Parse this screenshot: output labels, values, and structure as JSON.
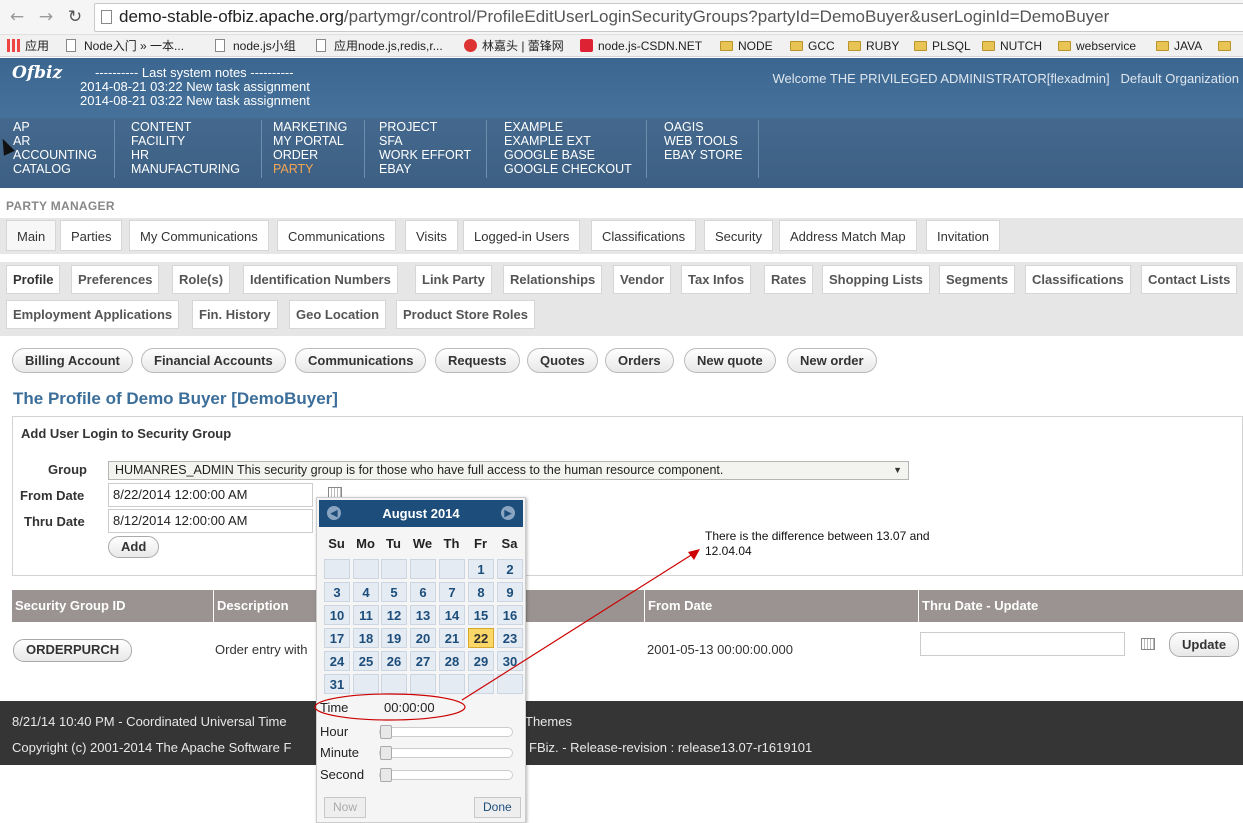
{
  "browser": {
    "url_host": "demo-stable-ofbiz.apache.org",
    "url_path": "/partymgr/control/ProfileEditUserLoginSecurityGroups?partyId=DemoBuyer&userLoginId=DemoBuyer",
    "bookmarks": [
      "应用",
      "Node入门 » 一本...",
      "node.js小组",
      "应用node.js,redis,r...",
      "林嘉头 | 蕾锋网",
      "node.js-CSDN.NET",
      "NODE",
      "GCC",
      "RUBY",
      "PLSQL",
      "NUTCH",
      "webservice",
      "JAVA"
    ]
  },
  "header": {
    "logo": "Ofbiz",
    "notes_title": "---------- Last system notes ----------",
    "notes": [
      "2014-08-21 03:22 New task assignment",
      "2014-08-21 03:22 New task assignment"
    ],
    "welcome": "Welcome THE PRIVILEGED ADMINISTRATOR[flexadmin]",
    "org": "Default Organization"
  },
  "apps": {
    "col1": [
      "AP",
      "AR",
      "ACCOUNTING",
      "CATALOG"
    ],
    "col2": [
      "CONTENT",
      "FACILITY",
      "HR",
      "MANUFACTURING"
    ],
    "col3": [
      "MARKETING",
      "MY PORTAL",
      "ORDER",
      "PARTY"
    ],
    "col4": [
      "PROJECT",
      "SFA",
      "WORK EFFORT",
      "EBAY"
    ],
    "col5": [
      "EXAMPLE",
      "EXAMPLE EXT",
      "GOOGLE BASE",
      "GOOGLE CHECKOUT"
    ],
    "col6": [
      "OAGIS",
      "WEB TOOLS",
      "EBAY STORE"
    ]
  },
  "party_manager": {
    "title": "PARTY MANAGER",
    "tabs": [
      "Main",
      "Parties",
      "My Communications",
      "Communications",
      "Visits",
      "Logged-in Users",
      "Classifications",
      "Security",
      "Address Match Map",
      "Invitation"
    ],
    "sub_tabs": [
      "Profile",
      "Preferences",
      "Role(s)",
      "Identification Numbers",
      "Link Party",
      "Relationships",
      "Vendor",
      "Tax Infos",
      "Rates",
      "Shopping Lists",
      "Segments",
      "Classifications",
      "Contact Lists",
      "Employment Applications",
      "Fin. History",
      "Geo Location",
      "Product Store Roles"
    ],
    "pills": [
      "Billing Account",
      "Financial Accounts",
      "Communications",
      "Requests",
      "Quotes",
      "Orders",
      "New quote",
      "New order"
    ]
  },
  "profile": {
    "title": "The Profile of Demo Buyer [DemoBuyer]",
    "form_title": "Add User Login to Security Group",
    "group_label": "Group",
    "group_value": "HUMANRES_ADMIN This security group is for those who have full access to the human resource component.",
    "from_label": "From Date",
    "from_value": "8/22/2014 12:00:00 AM",
    "thru_label": "Thru Date",
    "thru_value": "8/12/2014 12:00:00 AM",
    "add_label": "Add"
  },
  "grid": {
    "headers": [
      "Security Group ID",
      "Description",
      "From Date",
      "Thru Date - Update"
    ],
    "row": {
      "id": "ORDERPURCH",
      "desc": "Order entry with",
      "from": "2001-05-13 00:00:00.000",
      "thru": "",
      "update_label": "Update"
    }
  },
  "footer": {
    "line1a": "8/21/14 10:40 PM - Coordinated Universal Time",
    "line1b": "Themes",
    "line2a": "Copyright (c) 2001-2014 The Apache Software F",
    "line2b": "FBiz. - Release-revision : release13.07-r1619101"
  },
  "calendar": {
    "month": "August 2014",
    "dow": [
      "Su",
      "Mo",
      "Tu",
      "We",
      "Th",
      "Fr",
      "Sa"
    ],
    "weeks": [
      [
        "",
        "",
        "",
        "",
        "",
        "1",
        "2"
      ],
      [
        "3",
        "4",
        "5",
        "6",
        "7",
        "8",
        "9"
      ],
      [
        "10",
        "11",
        "12",
        "13",
        "14",
        "15",
        "16"
      ],
      [
        "17",
        "18",
        "19",
        "20",
        "21",
        "22",
        "23"
      ],
      [
        "24",
        "25",
        "26",
        "27",
        "28",
        "29",
        "30"
      ],
      [
        "31",
        "",
        "",
        "",
        "",
        "",
        ""
      ]
    ],
    "today": "22",
    "time_label": "Time",
    "time_value": "00:00:00",
    "hour_label": "Hour",
    "minute_label": "Minute",
    "second_label": "Second",
    "now_label": "Now",
    "done_label": "Done"
  },
  "annotation": "There is the difference between 13.07 and 12.04.04",
  "colors": {
    "header_blue": "#3b6690",
    "active_app": "#f5a553",
    "calendar_head": "#1c4d7b",
    "grid_head": "#9a9392",
    "footer_bg": "#353535",
    "annotation_red": "#cc0000"
  }
}
